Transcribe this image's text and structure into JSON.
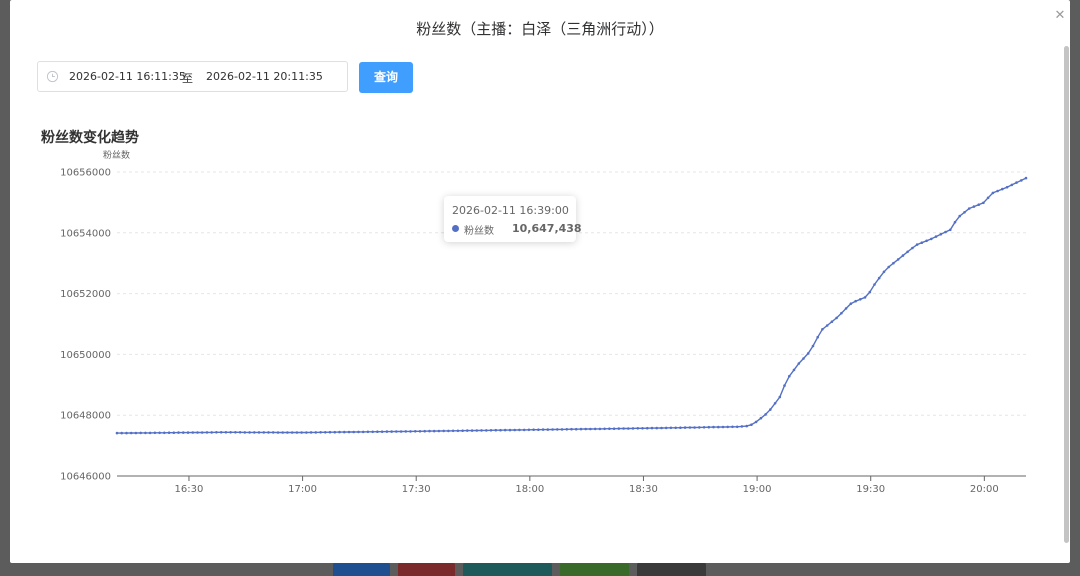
{
  "dialog": {
    "title": "粉丝数（主播：白泽（三角洲行动））",
    "close_icon": "close-icon"
  },
  "filter": {
    "start": "2026-02-11 16:11:35",
    "separator": "至",
    "end": "2026-02-11 20:11:35",
    "query_label": "查询"
  },
  "tooltip": {
    "time": "2026-02-11 16:39:00",
    "series_name": "粉丝数",
    "value": "10,647,438"
  },
  "colors": {
    "series": "#5470c6",
    "button": "#409eff"
  },
  "chart_data": {
    "type": "line",
    "title": "粉丝数变化趋势",
    "ylabel": "粉丝数",
    "xlabel": "",
    "grid": true,
    "ylim": [
      10646000,
      10656000
    ],
    "xlim": [
      "16:11",
      "20:11"
    ],
    "y_ticks": [
      "10646000",
      "10648000",
      "10650000",
      "10652000",
      "10654000",
      "10656000"
    ],
    "x_ticks": [
      "16:30",
      "17:00",
      "17:30",
      "18:00",
      "18:30",
      "19:00",
      "19:30",
      "20:00"
    ],
    "x_tick_minutes": [
      990,
      1020,
      1050,
      1080,
      1110,
      1140,
      1170,
      1200
    ],
    "series": [
      {
        "name": "粉丝数",
        "points": [
          [
            "16:11",
            10647410
          ],
          [
            "16:39",
            10647438
          ],
          [
            "17:00",
            10647430
          ],
          [
            "17:30",
            10647470
          ],
          [
            "18:00",
            10647520
          ],
          [
            "18:30",
            10647570
          ],
          [
            "18:55",
            10647620
          ],
          [
            "18:58",
            10647650
          ],
          [
            "19:00",
            10647800
          ],
          [
            "19:03",
            10648100
          ],
          [
            "19:06",
            10648600
          ],
          [
            "19:08",
            10649200
          ],
          [
            "19:11",
            10649700
          ],
          [
            "19:14",
            10650100
          ],
          [
            "19:17",
            10650800
          ],
          [
            "19:21",
            10651200
          ],
          [
            "19:25",
            10651700
          ],
          [
            "19:29",
            10651900
          ],
          [
            "19:31",
            10652300
          ],
          [
            "19:34",
            10652800
          ],
          [
            "19:38",
            10653200
          ],
          [
            "19:42",
            10653600
          ],
          [
            "19:46",
            10653800
          ],
          [
            "19:51",
            10654100
          ],
          [
            "19:53",
            10654500
          ],
          [
            "19:56",
            10654800
          ],
          [
            "20:00",
            10655000
          ],
          [
            "20:02",
            10655300
          ],
          [
            "20:06",
            10655500
          ],
          [
            "20:11",
            10655800
          ]
        ]
      }
    ]
  }
}
